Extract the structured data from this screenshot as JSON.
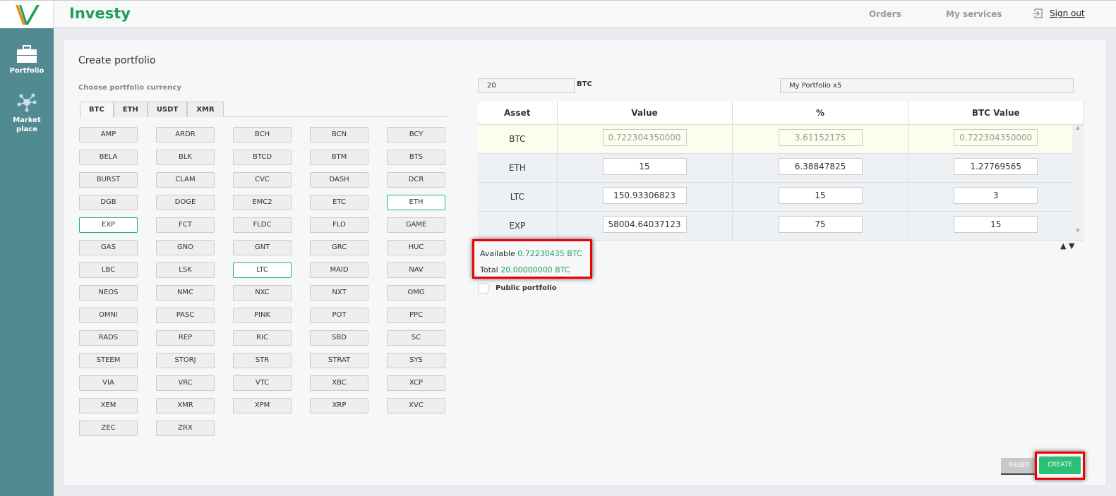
{
  "header": {
    "brand": "Investy",
    "nav": [
      "Orders",
      "My services"
    ],
    "signout": "Sign out"
  },
  "sidebar": [
    {
      "label": "Portfolio"
    },
    {
      "label": "Market place"
    }
  ],
  "page": {
    "title": "Create portfolio",
    "currency_label": "Choose portfolio currency",
    "tabs": [
      "BTC",
      "ETH",
      "USDT",
      "XMR"
    ],
    "coins": [
      "AMP",
      "ARDR",
      "BCH",
      "BCN",
      "BCY",
      "BELA",
      "BLK",
      "BTCD",
      "BTM",
      "BTS",
      "BURST",
      "CLAM",
      "CVC",
      "DASH",
      "DCR",
      "DGB",
      "DOGE",
      "EMC2",
      "ETC",
      "ETH",
      "EXP",
      "FCT",
      "FLDC",
      "FLO",
      "GAME",
      "GAS",
      "GNO",
      "GNT",
      "GRC",
      "HUC",
      "LBC",
      "LSK",
      "LTC",
      "MAID",
      "NAV",
      "NEOS",
      "NMC",
      "NXC",
      "NXT",
      "OMG",
      "OMNI",
      "PASC",
      "PINK",
      "POT",
      "PPC",
      "RADS",
      "REP",
      "RIC",
      "SBD",
      "SC",
      "STEEM",
      "STORJ",
      "STR",
      "STRAT",
      "SYS",
      "VIA",
      "VRC",
      "VTC",
      "XBC",
      "XCP",
      "XEM",
      "XMR",
      "XPM",
      "XRP",
      "XVC",
      "ZEC",
      "ZRX"
    ],
    "selected": [
      "ETH",
      "EXP",
      "LTC"
    ],
    "amount": "20",
    "amount_unit": "BTC",
    "portfolio_name": "My Portfolio x5",
    "table": {
      "headers": [
        "Asset",
        "Value",
        "%",
        "BTC Value"
      ],
      "rows": [
        [
          "BTC",
          "0.722304350000",
          "3.61152175",
          "0.722304350000"
        ],
        [
          "ETH",
          "15",
          "6.38847825",
          "1.27769565"
        ],
        [
          "LTC",
          "150.93306823",
          "15",
          "3"
        ],
        [
          "EXP",
          "58004.64037123",
          "75",
          "15"
        ]
      ]
    },
    "available_label": "Available",
    "available_value": "0.72230435 BTC",
    "total_label": "Total",
    "total_value": "20.00000000 BTC",
    "public_label": "Public portfolio",
    "reset": "RESET",
    "create": "CREATE"
  }
}
